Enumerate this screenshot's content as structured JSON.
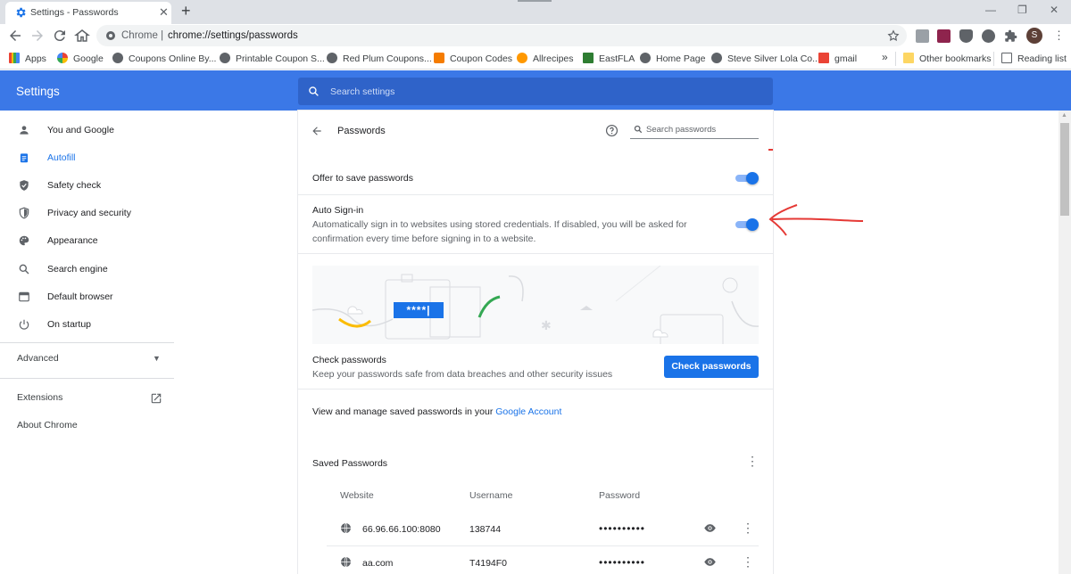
{
  "browser": {
    "tab_title": "Settings - Passwords",
    "omnibox_prefix": "Chrome  |",
    "url": "chrome://settings/passwords",
    "profile_initial": "S"
  },
  "bookmarks": {
    "items": [
      "Apps",
      "Google",
      "Coupons Online By...",
      "Printable Coupon S...",
      "Red Plum Coupons...",
      "Coupon Codes",
      "Allrecipes",
      "EastFLA",
      "Home Page",
      "Steve Silver Lola Co...",
      "gmail"
    ],
    "overflow": "»",
    "other": "Other bookmarks",
    "reading_list": "Reading list"
  },
  "header": {
    "title": "Settings",
    "search_placeholder": "Search settings"
  },
  "sidebar": {
    "items": [
      {
        "label": "You and Google",
        "icon": "person-icon"
      },
      {
        "label": "Autofill",
        "icon": "clipboard-icon"
      },
      {
        "label": "Safety check",
        "icon": "shield-check-icon"
      },
      {
        "label": "Privacy and security",
        "icon": "shield-icon"
      },
      {
        "label": "Appearance",
        "icon": "palette-icon"
      },
      {
        "label": "Search engine",
        "icon": "search-icon"
      },
      {
        "label": "Default browser",
        "icon": "browser-icon"
      },
      {
        "label": "On startup",
        "icon": "power-icon"
      }
    ],
    "advanced": "Advanced",
    "extensions": "Extensions",
    "about": "About Chrome"
  },
  "passwords": {
    "page_title": "Passwords",
    "search_placeholder": "Search passwords",
    "offer_to_save": "Offer to save passwords",
    "offer_to_save_on": true,
    "auto_signin_title": "Auto Sign-in",
    "auto_signin_desc": "Automatically sign in to websites using stored credentials. If disabled, you will be asked for confirmation every time before signing in to a website.",
    "auto_signin_on": true,
    "banner_text": "****|",
    "check_title": "Check passwords",
    "check_desc": "Keep your passwords safe from data breaches and other security issues",
    "check_button": "Check passwords",
    "manage_text": "View and manage saved passwords in your",
    "manage_link": "Google Account",
    "saved_title": "Saved Passwords",
    "columns": [
      "Website",
      "Username",
      "Password"
    ],
    "rows": [
      {
        "website": "66.96.66.100:8080",
        "username": "138744",
        "password": "••••••••••"
      },
      {
        "website": "aa.com",
        "username": "T4194F0",
        "password": "••••••••••"
      }
    ]
  },
  "colors": {
    "accent": "#1a73e8",
    "header": "#3b78e7",
    "annotation": "#e53935"
  }
}
